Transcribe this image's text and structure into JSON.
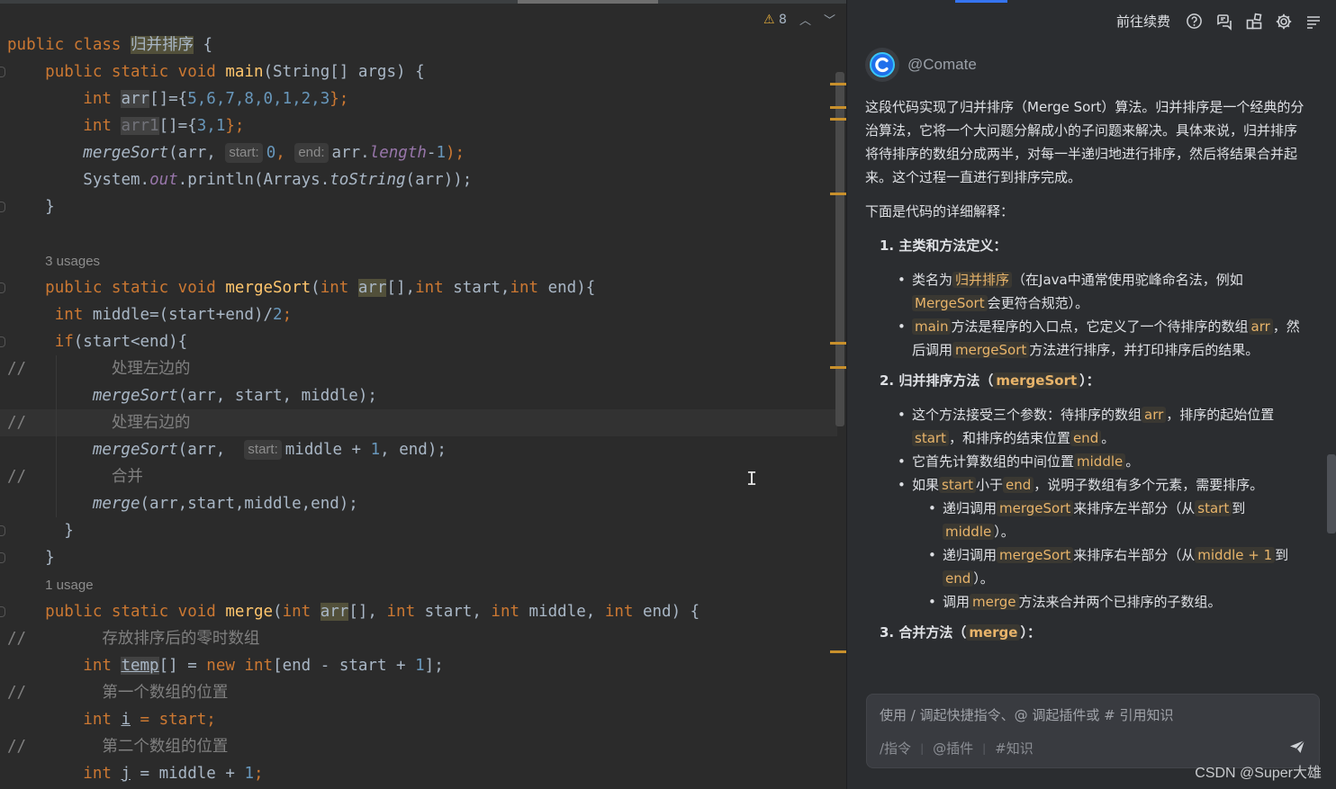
{
  "editor": {
    "inspection": {
      "warning_icon": "⚠",
      "warning_count": "8"
    },
    "code": {
      "l1": {
        "kw1": "public",
        "kw2": "class",
        "name": "归并排序",
        "brace": " {"
      },
      "l2": {
        "sig": "public static void ",
        "fn": "main",
        "rest": "(String[] args) {"
      },
      "l3": {
        "kw": "int",
        "var": "arr",
        "rest": "[]={",
        "nums": "5,6,7,8,0,1,2,3",
        "end": "};"
      },
      "l4": {
        "kw": "int",
        "var": "arr1",
        "rest": "[]={",
        "nums": "3,1",
        "end": "};"
      },
      "l5": {
        "fn": "mergeSort",
        "a": "(arr, ",
        "hint1": "start:",
        "n0": "0",
        "b": ", ",
        "hint2": "end:",
        "c": "arr.",
        "len": "length",
        "d": "-",
        "n1": "1",
        "e": ");"
      },
      "l6": {
        "a": "System.",
        "out": "out",
        "b": ".println(Arrays.",
        "fn": "toString",
        "c": "(arr));"
      },
      "l7": "}",
      "usages1": "3 usages",
      "l9": {
        "sig": "public static void ",
        "fn": "mergeSort",
        "p1": "(",
        "k1": "int",
        "v1": "arr",
        "p2": "[],",
        "k2": "int",
        "p3": " start,",
        "k3": "int",
        "p4": " end){"
      },
      "l10": {
        "kw": "int",
        "a": " middle=(start+end)/",
        "n": "2",
        "e": ";"
      },
      "l11": {
        "kw": "if",
        "a": "(start<end){"
      },
      "l12": {
        "slash": "//",
        "text": "处理左边的"
      },
      "l13": {
        "fn": "mergeSort",
        "a": "(arr, start, middle);"
      },
      "l14": {
        "slash": "//",
        "text": "处理右边的"
      },
      "l15": {
        "fn": "mergeSort",
        "a": "(arr, ",
        "hint": "start:",
        "b": "middle + ",
        "n": "1",
        "c": ", end);"
      },
      "l16": {
        "slash": "//",
        "text": "合并"
      },
      "l17": {
        "fn": "merge",
        "a": "(arr,start,middle,end);"
      },
      "l18": "}",
      "l19": "}",
      "usages2": "1 usage",
      "l21": {
        "sig": "public static void ",
        "fn": "merge",
        "p1": "(",
        "k1": "int",
        "v1": "arr",
        "p2": "[], ",
        "k2": "int",
        "p3": " start, ",
        "k3": "int",
        "p4": " middle, ",
        "k4": "int",
        "p5": " end) {"
      },
      "l22": {
        "slash": "//",
        "text": "存放排序后的零时数组"
      },
      "l23": {
        "kw": "int",
        "var": "temp",
        "a": "[] = ",
        "kw2": "new",
        "kw3": "int",
        "b": "[end - start + ",
        "n": "1",
        "c": "];"
      },
      "l24": {
        "slash": "//",
        "text": "第一个数组的位置"
      },
      "l25": {
        "kw": "int",
        "var": "i",
        "a": " = start;"
      },
      "l26": {
        "slash": "//",
        "text": "第二个数组的位置"
      },
      "l27": {
        "kw": "int",
        "var": "j",
        "a": " = middle + ",
        "n": "1",
        "c": ";"
      }
    }
  },
  "panel": {
    "continue_label": "前往续费",
    "toolbar_icons": [
      "help-icon",
      "chat-feedback-icon",
      "plugins-icon",
      "settings-icon",
      "menu-icon"
    ],
    "bot_name": "@Comate",
    "message": {
      "intro": "这段代码实现了归并排序（Merge Sort）算法。归并排序是一个经典的分治算法，它将一个大问题分解成小的子问题来解决。具体来说，归并排序将待排序的数组分成两半，对每一半递归地进行排序，然后将结果合并起来。这个过程一直进行到排序完成。",
      "detail_lead": "下面是代码的详细解释：",
      "s1_title": "1. 主类和方法定义：",
      "s1_b1_a": "类名为",
      "s1_b1_code": "归并排序",
      "s1_b1_b": "（在Java中通常使用驼峰命名法，例如",
      "s1_b1_code2": "MergeSort",
      "s1_b1_c": "会更符合规范）。",
      "s1_b2_code": "main",
      "s1_b2_a": "方法是程序的入口点，它定义了一个待排序的数组",
      "s1_b2_code2": "arr",
      "s1_b2_b": "，然后调用",
      "s1_b2_code3": "mergeSort",
      "s1_b2_c": "方法进行排序，并打印排序后的结果。",
      "s2_title_a": "2. 归并排序方法（",
      "s2_title_code": "mergeSort",
      "s2_title_b": "）：",
      "s2_b1_a": "这个方法接受三个参数：待排序的数组",
      "s2_b1_c1": "arr",
      "s2_b1_b": "，排序的起始位置",
      "s2_b1_c2": "start",
      "s2_b1_c": "，和排序的结束位置",
      "s2_b1_c3": "end",
      "s2_b1_d": "。",
      "s2_b2_a": "它首先计算数组的中间位置",
      "s2_b2_c": "middle",
      "s2_b2_b": "。",
      "s2_b3_a": "如果",
      "s2_b3_c1": "start",
      "s2_b3_b": "小于",
      "s2_b3_c2": "end",
      "s2_b3_c": "，说明子数组有多个元素，需要排序。",
      "s2_sub1_a": "递归调用",
      "s2_sub1_c1": "mergeSort",
      "s2_sub1_b": "来排序左半部分（从",
      "s2_sub1_c2": "start",
      "s2_sub1_c": "到",
      "s2_sub1_c3": "middle",
      "s2_sub1_d": "）。",
      "s2_sub2_a": "递归调用",
      "s2_sub2_c1": "mergeSort",
      "s2_sub2_b": "来排序右半部分（从",
      "s2_sub2_c2": "middle + 1",
      "s2_sub2_c": "到",
      "s2_sub2_c3": "end",
      "s2_sub2_d": "）。",
      "s2_sub3_a": "调用",
      "s2_sub3_c": "merge",
      "s2_sub3_b": "方法来合并两个已排序的子数组。",
      "s3_title_a": "3. 合并方法（",
      "s3_title_code": "merge",
      "s3_title_b": "）："
    },
    "input": {
      "placeholder": "使用 / 调起快捷指令、@ 调起插件或 # 引用知识",
      "cmd": "/指令",
      "plugin": "@插件",
      "knowledge": "#知识",
      "sep": "|"
    },
    "watermark": "CSDN @Super大雄"
  },
  "colors": {
    "editor_bg": "#2b2b2b",
    "keyword": "#cc7832",
    "number": "#6897bb",
    "function": "#ffc66d",
    "comment": "#808080",
    "panel_bg": "#2b2d30",
    "inline_code": "#e8b46a"
  }
}
